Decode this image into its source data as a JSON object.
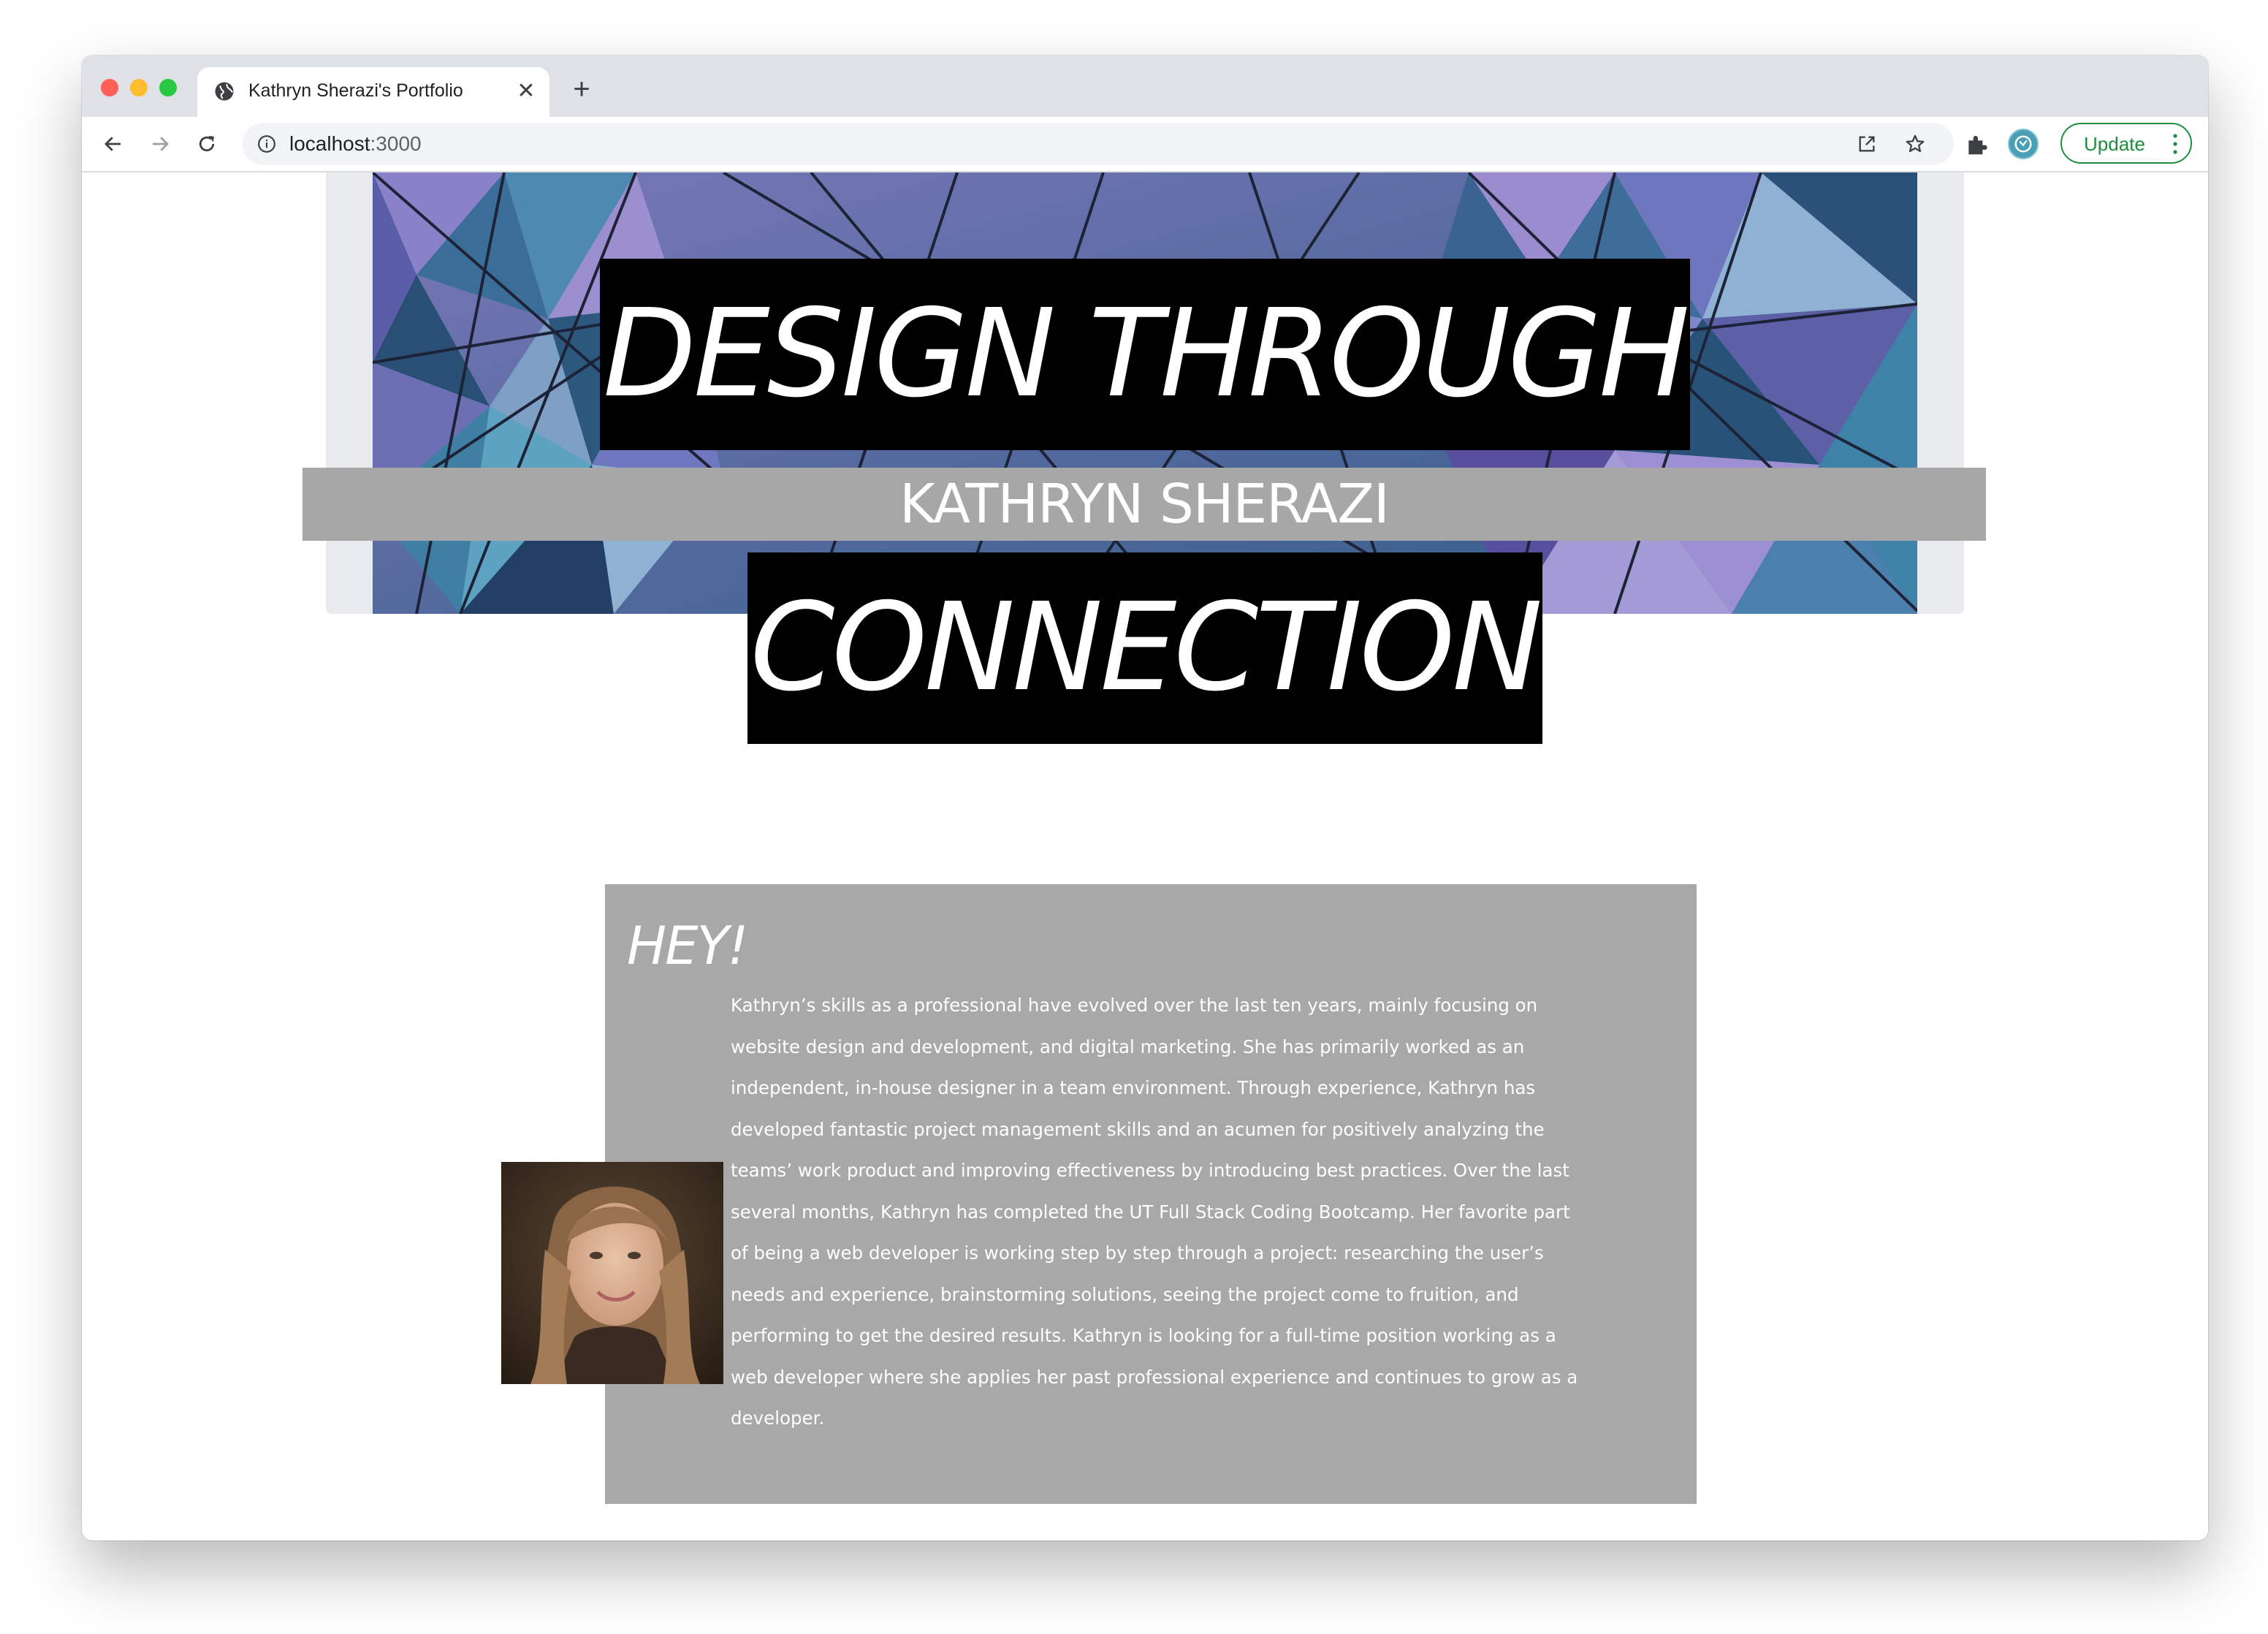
{
  "browser": {
    "tab": {
      "title": "Kathryn Sherazi's Portfolio",
      "close_glyph": "✕",
      "favicon": "globe-icon"
    },
    "new_tab_glyph": "+",
    "address": {
      "host": "localhost",
      "port": ":3000"
    },
    "update_label": "Update",
    "icons": [
      "back-arrow-icon",
      "forward-arrow-icon",
      "reload-icon",
      "info-icon",
      "open-in-icon",
      "star-icon",
      "puzzle-icon",
      "avatar",
      "more-vert-icon"
    ],
    "colors": {
      "tabstrip": "#dee1e6",
      "update_green": "#1e8e3e",
      "omnibox": "#f1f3f4"
    }
  },
  "hero": {
    "line1": "DESIGN THROUGH",
    "line2": "CONNECTION",
    "name": "KATHRYN SHERAZI",
    "colors": {
      "box": "#000000",
      "band": "#a7a7a7",
      "frame": "#e9eaee"
    }
  },
  "about": {
    "heading": "HEY!",
    "paragraph": "Kathryn’s skills as a professional have evolved over the last ten years, mainly focusing on website design and development, and digital marketing. She has primarily worked as an independent, in-house designer in a team environment. Through experience, Kathryn has developed fantastic project management skills and an acumen for positively analyzing the teams’ work product and improving effectiveness by introducing best practices. Over the last several months, Kathryn has completed the UT Full Stack Coding Bootcamp. Her favorite part of being a web developer is working step by step through a project: researching the user’s needs and experience, brainstorming solutions, seeing the project come to fruition, and performing to get the desired results. Kathryn is looking for a full-time position working as a web developer where she applies her past professional experience and continues to grow as a developer.",
    "card_color": "#a8a8a8"
  }
}
